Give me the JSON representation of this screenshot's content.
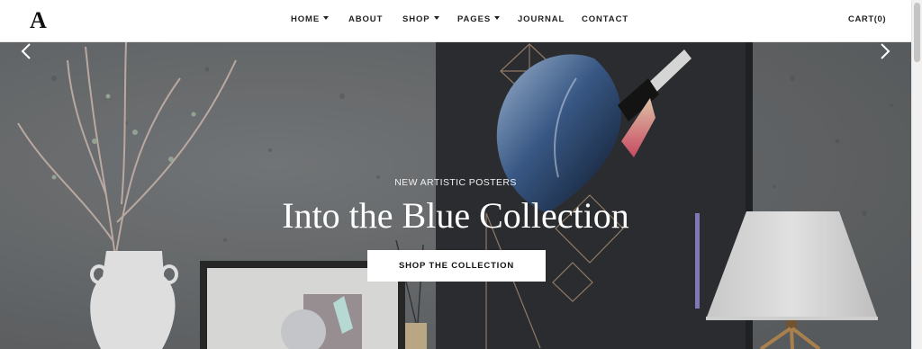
{
  "header": {
    "logo": "A",
    "nav": [
      {
        "label": "HOME",
        "has_dropdown": true
      },
      {
        "label": "ABOUT",
        "has_dropdown": false
      },
      {
        "label": "SHOP",
        "has_dropdown": true
      },
      {
        "label": "PAGES",
        "has_dropdown": true
      },
      {
        "label": "JOURNAL",
        "has_dropdown": false
      },
      {
        "label": "CONTACT",
        "has_dropdown": false
      }
    ],
    "cart_label": "CART(0)"
  },
  "hero": {
    "kicker": "NEW ARTISTIC POSTERS",
    "headline": "Into the Blue Collection",
    "cta_label": "SHOP THE COLLECTION",
    "prev_icon": "chevron-left-icon",
    "next_icon": "chevron-right-icon"
  },
  "colors": {
    "wall": "#6f7274",
    "poster": "#2f3033",
    "accent_blue": "#4a6a9a",
    "text_dark": "#222222"
  }
}
